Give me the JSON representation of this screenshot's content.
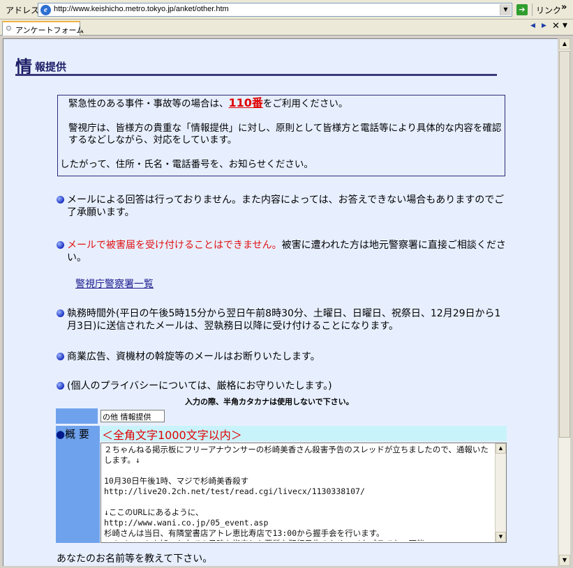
{
  "browser": {
    "address_label": "アドレス",
    "url": "http://www.keishicho.metro.tokyo.jp/anket/other.htm",
    "links_label": "リンク",
    "links_chevron": "»",
    "tab_title": "アンケートフォーム"
  },
  "page": {
    "heading_big": "情",
    "heading_small": "報提供",
    "notice": {
      "line1_pre": "緊急性のある事件・事故等の場合は、",
      "line1_em": "110番",
      "line1_post": "をご利用ください。",
      "line2": "警視庁は、皆様方の貴重な「情報提供」に対し、原則として皆様方と電話等により具体的な内容を確認するなどしながら、対応をしています。",
      "line3": "したがって、住所・氏名・電話番号を、お知らせください。"
    },
    "bullets": {
      "b1": "メールによる回答は行っておりません。また内容によっては、お答えできない場合もありますのでご了承願います。",
      "b2_red": "メールで被害届を受け付けることはできません。",
      "b2_rest": "被害に遭われた方は地元警察署に直接ご相談ください。",
      "police_link": "警視庁警察署一覧",
      "b3": "執務時間外(平日の午後5時15分から翌日午前8時30分、土曜日、日曜日、祝祭日、12月29日から1月3日)に送信されたメールは、翌執務日以降に受け付けることになります。",
      "b4": "商業広告、資機材の斡旋等のメールはお断りいたします。",
      "b5": "(個人のプライバシーについては、厳格にお守りいたします。)"
    },
    "kana_note": "入力の際、半角カタカナは使用しないで下さい。",
    "form": {
      "category_value": "の他 情報提供",
      "summary_bullet": "●",
      "summary_label": "概 要",
      "summary_hint": "＜全角文字1000文字以内＞",
      "summary_text": "２ちゃんねる掲示板にフリーアナウンサーの杉崎美香さん殺害予告のスレッドが立ちましたので、通報いたします。↓\n\n10月30日午後1時、マジで杉崎美香殺す\nhttp://live20.2ch.net/test/read.cgi/livecx/1130338107/\n\n↓ここのURLにあるように、\nhttp://www.wani.co.jp/05_event.asp\n杉崎さんは当日、有隣堂書店アトレ恵比寿店で13:00から握手会を行います。\nこのイベントを知った上での日時を指定した悪質な犯行予告のため、イタズラでない可能"
    },
    "name_prompt": "あなたのお名前等を教えて下さい。"
  }
}
